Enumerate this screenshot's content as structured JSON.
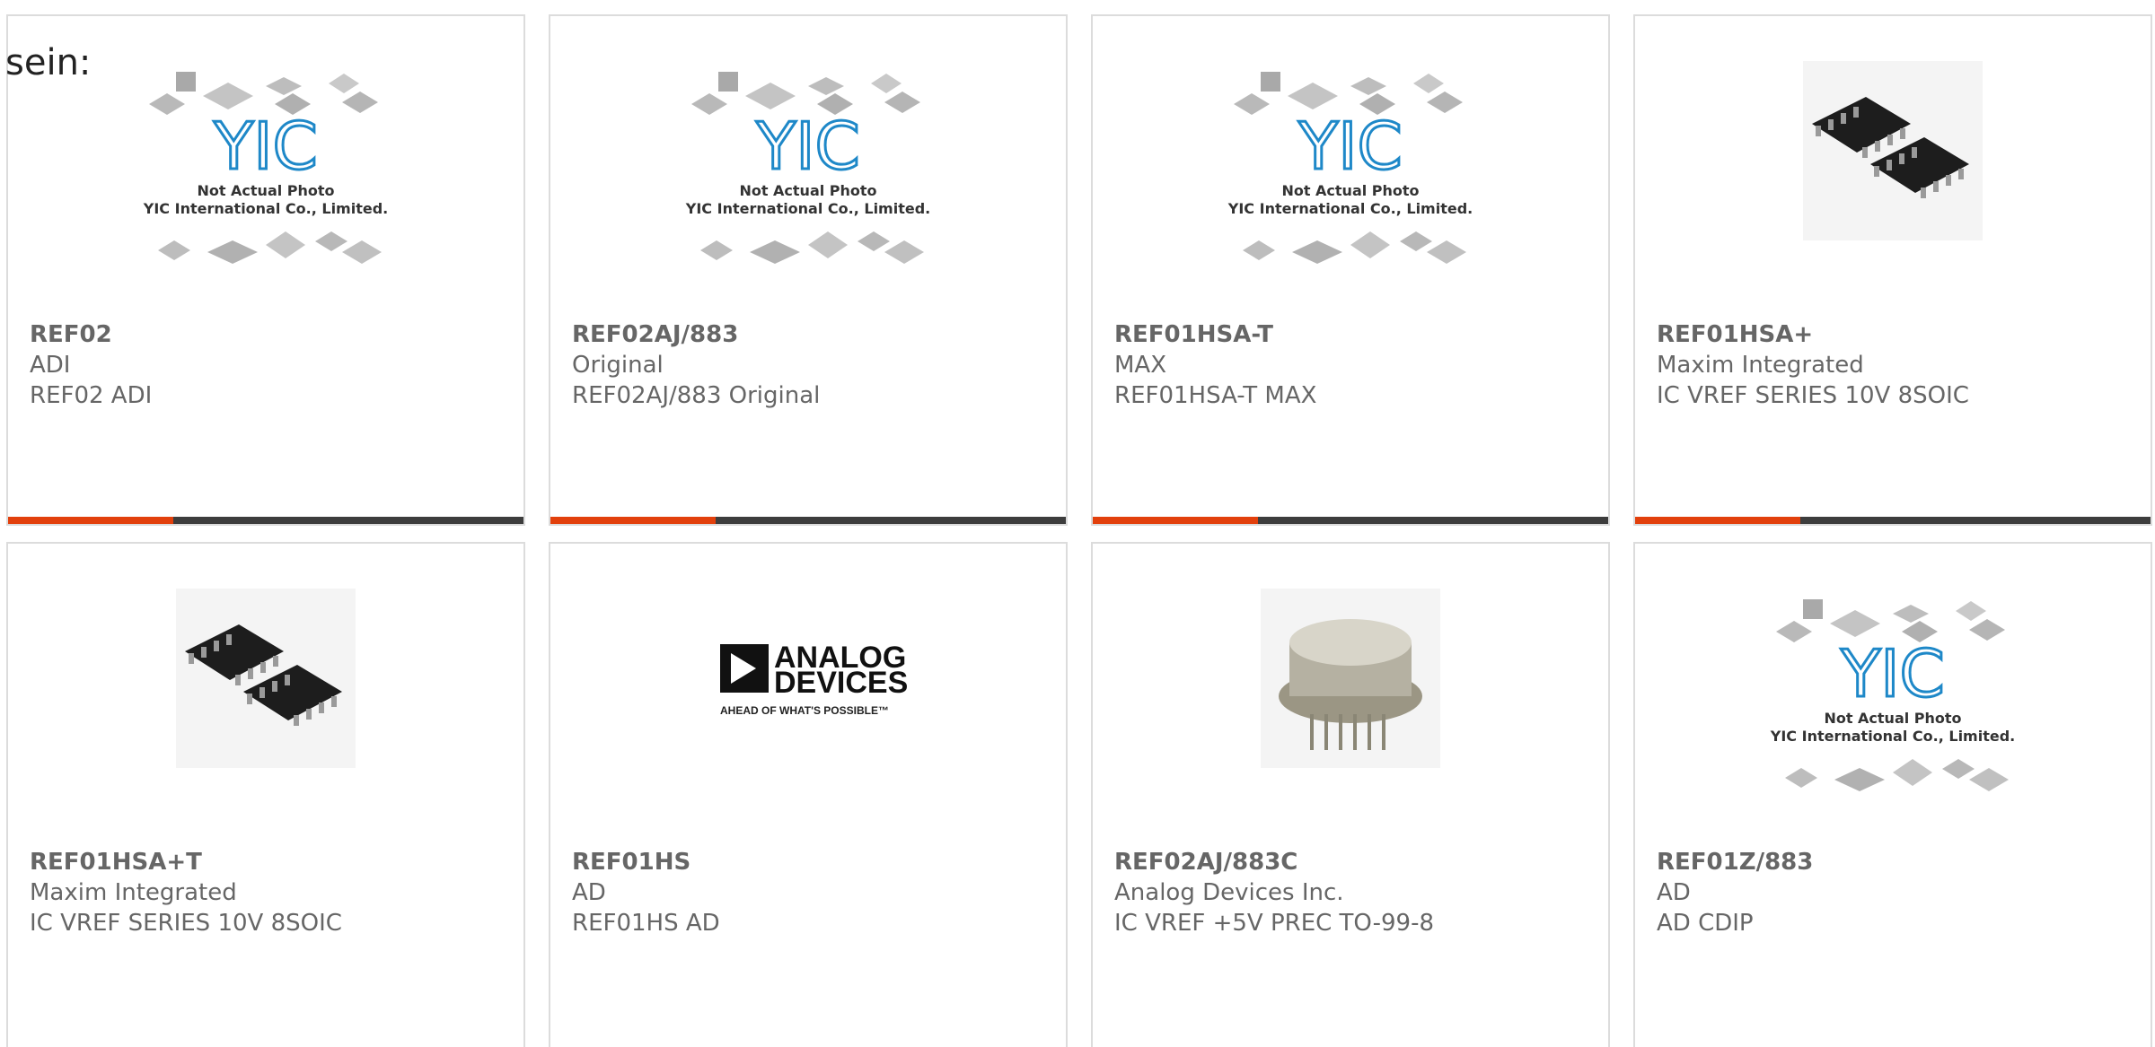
{
  "intro_text": "sein:",
  "colors": {
    "accent": "#e2400c",
    "bar_track": "#3d3d3d",
    "text": "#666666",
    "border": "#dcdcdc",
    "yic_blue": "#1e88c8"
  },
  "placeholder": {
    "line1": "Not Actual Photo",
    "line2": "YIC International Co., Limited.",
    "logo_text": "YIC"
  },
  "analog_logo": {
    "line1": "ANALOG",
    "line2": "DEVICES",
    "tagline": "AHEAD OF WHAT'S POSSIBLE™"
  },
  "products": [
    {
      "part": "REF02",
      "maker": "ADI",
      "desc": "REF02 ADI",
      "image": "placeholder-icon",
      "highlight": 0.32
    },
    {
      "part": "REF02AJ/883",
      "maker": "Original",
      "desc": "REF02AJ/883 Original",
      "image": "placeholder-icon",
      "highlight": 0.32
    },
    {
      "part": "REF01HSA-T",
      "maker": "MAX",
      "desc": "REF01HSA-T MAX",
      "image": "placeholder-icon",
      "highlight": 0.32
    },
    {
      "part": "REF01HSA+",
      "maker": "Maxim Integrated",
      "desc": "IC VREF SERIES 10V 8SOIC",
      "image": "soic-chip-icon",
      "highlight": 0.32
    },
    {
      "part": "REF01HSA+T",
      "maker": "Maxim Integrated",
      "desc": "IC VREF SERIES 10V 8SOIC",
      "image": "soic-chip-icon",
      "highlight": 0
    },
    {
      "part": "REF01HS",
      "maker": "AD",
      "desc": "REF01HS AD",
      "image": "analog-devices-logo",
      "highlight": 0
    },
    {
      "part": "REF02AJ/883C",
      "maker": "Analog Devices Inc.",
      "desc": "IC VREF +5V PREC TO-99-8",
      "image": "to99-can-icon",
      "highlight": 0
    },
    {
      "part": "REF01Z/883",
      "maker": "AD",
      "desc": "AD CDIP",
      "image": "placeholder-icon",
      "highlight": 0
    }
  ]
}
